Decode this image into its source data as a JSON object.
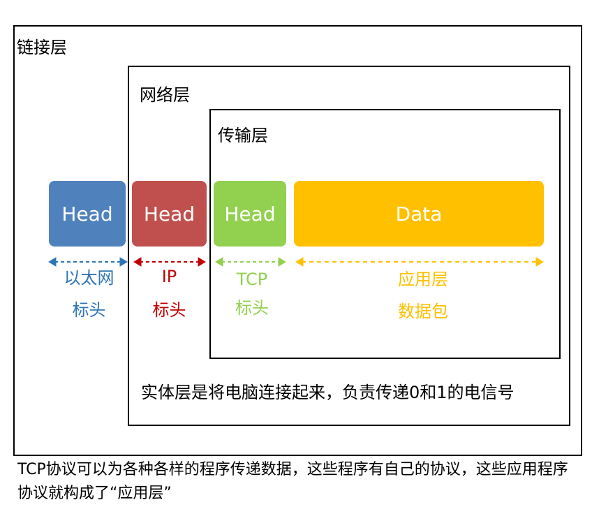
{
  "layers": {
    "link": "链接层",
    "network": "网络层",
    "transport": "传输层"
  },
  "packets": [
    {
      "label": "Head",
      "color": "#4f81bd"
    },
    {
      "label": "Head",
      "color": "#c0504d"
    },
    {
      "label": "Head",
      "color": "#92d050"
    },
    {
      "label": "Data",
      "color": "#ffc000"
    }
  ],
  "captions": [
    {
      "line1": "以太网",
      "line2": "标头",
      "color": "#2e75b6"
    },
    {
      "line1": "IP",
      "line2": "标头",
      "color": "#c00000"
    },
    {
      "line1": "TCP",
      "line2": "标头",
      "color": "#92d050"
    },
    {
      "line1": "应用层",
      "line2": "数据包",
      "color": "#ffc000"
    }
  ],
  "physical_note": "实体层是将电脑连接起来，负责传递0和1的电信号",
  "footer_caption": "TCP协议可以为各种各样的程序传递数据，这些程序有自己的协议，这些应用程序协议就构成了“应用层”"
}
